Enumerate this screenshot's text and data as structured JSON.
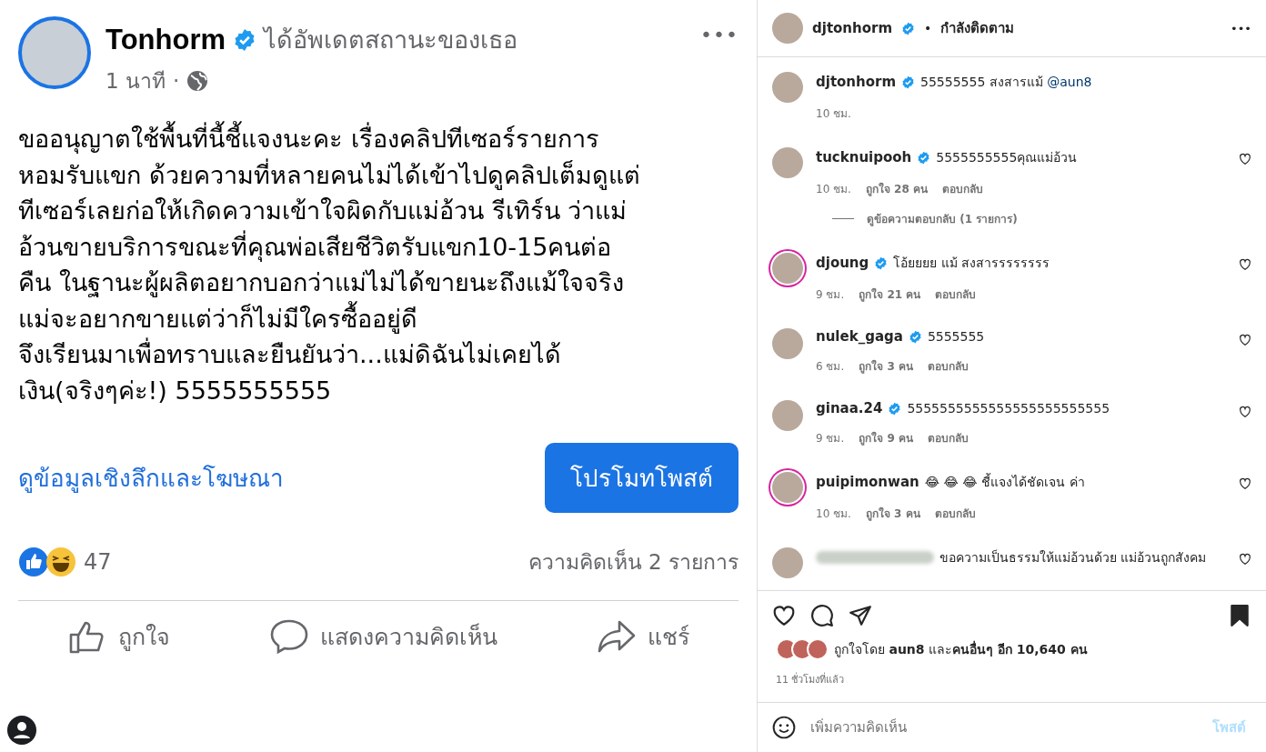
{
  "post": {
    "author": "Tonhorm",
    "verified": true,
    "action": "ได้อัพเดตสถานะของเธอ",
    "time": "1 นาที",
    "separator": "·",
    "more": "•••",
    "text": "ขออนุญาตใช้พื้นที่นี้ชี้แจงนะคะ เรื่องคลิปทีเซอร์รายการ\nหอมรับแขก ด้วยความที่หลายคนไม่ได้เข้าไปดูคลิปเต็มดูแต่\nทีเซอร์เลยก่อให้เกิดความเข้าใจผิดกับแม่อ้วน รีเทิร์น ว่าแม่\nอ้วนขายบริการขณะที่คุณพ่อเสียชีวิตรับแขก10-15คนต่อ\nคืน ในฐานะผู้ผลิตอยากบอกว่าแม่ไม่ได้ขายนะถึงแม้ใจจริง\nแม่จะอยากขายแต่ว่าก็ไม่มีใครซื้ออยู่ดี\nจึงเรียนมาเพื่อทราบและยืนยันว่า...แม่ดิฉันไม่เคยได้\nเงิน(จริงๆค่ะ!) 5555555555",
    "insights_link": "ดูข้อมูลเชิงลึกและโฆษณา",
    "promote_button": "โปรโมทโพสต์",
    "reaction_count": "47",
    "comment_count": "ความคิดเห็น 2 รายการ",
    "actions": [
      {
        "kind": "like",
        "label": "ถูกใจ"
      },
      {
        "kind": "comment",
        "label": "แสดงความคิดเห็น"
      },
      {
        "kind": "share",
        "label": "แชร์"
      }
    ]
  },
  "instagram": {
    "username": "djtonhorm",
    "verified": true,
    "separator": "•",
    "follow_status": "กำลังติดตาม",
    "more": "•••",
    "caption": {
      "username": "djtonhorm",
      "verified": true,
      "text": "55555555 สงสารแม้ ",
      "mention": "@aun8",
      "time": "10 ชม."
    },
    "comments": [
      {
        "username": "tucknuipooh",
        "verified": true,
        "story_ring": false,
        "text": "5555555555คุณแม่อ้วน",
        "time": "10 ชม.",
        "likes": "ถูกใจ 28 คน",
        "reply": "ตอบกลับ",
        "view_replies": "ดูข้อความตอบกลับ (1 รายการ)",
        "blurred": false
      },
      {
        "username": "djoung",
        "verified": true,
        "story_ring": true,
        "text": "โอ้ยยยย แม้ สงสารรรรรรรร",
        "time": "9 ชม.",
        "likes": "ถูกใจ 21 คน",
        "reply": "ตอบกลับ",
        "blurred": false
      },
      {
        "username": "nulek_gaga",
        "verified": true,
        "story_ring": false,
        "text": "5555555",
        "time": "6 ชม.",
        "likes": "ถูกใจ 3 คน",
        "reply": "ตอบกลับ",
        "blurred": false
      },
      {
        "username": "ginaa.24",
        "verified": true,
        "story_ring": false,
        "text": "5555555555555555555555555",
        "time": "9 ชม.",
        "likes": "ถูกใจ 9 คน",
        "reply": "ตอบกลับ",
        "blurred": false
      },
      {
        "username": "puipimonwan",
        "verified": false,
        "story_ring": true,
        "text": "😂 😂 😂  ชี้แจงได้ชัดเจน ค่า",
        "time": "10 ชม.",
        "likes": "ถูกใจ 3 คน",
        "reply": "ตอบกลับ",
        "blurred": false
      },
      {
        "verified": false,
        "story_ring": false,
        "text": "ขอความเป็นธรรมให้แม่อ้วนด้วย แม่อ้วนถูกสังคม",
        "blurred": true
      }
    ],
    "liked_by": "ถูกใจโดย **aun8** และ**คนอื่นๆ อีก 10,640 คน**",
    "ago": "11 ชั่วโมงที่แล้ว",
    "saved": true,
    "comment_placeholder": "เพิ่มความคิดเห็น",
    "post_button": "โพสต์"
  }
}
